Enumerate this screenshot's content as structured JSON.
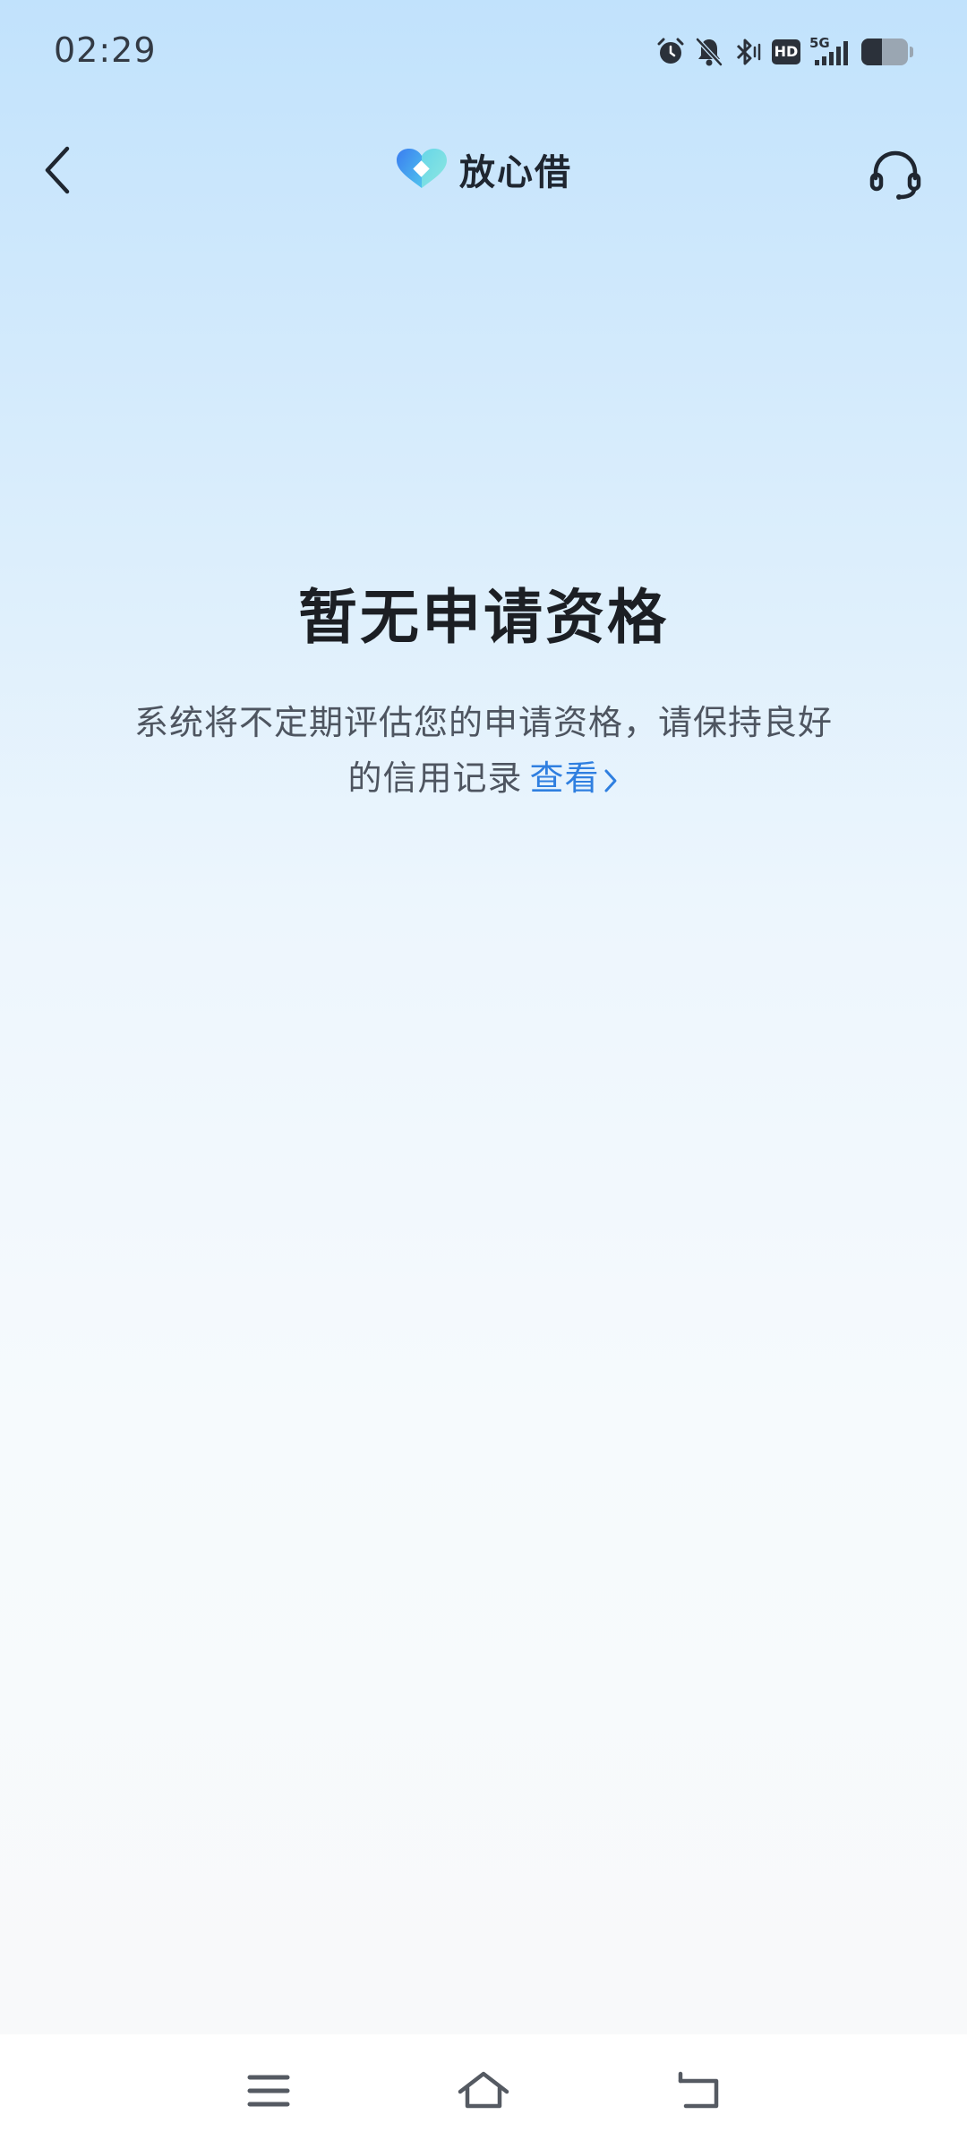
{
  "status_bar": {
    "time": "02:29",
    "icons": [
      "alarm-icon",
      "bell-off-icon",
      "bluetooth-icon",
      "hd-icon",
      "signal-5g-icon",
      "battery-icon"
    ],
    "hd_label": "HD",
    "network_label": "5G",
    "battery_level": 0.45
  },
  "nav": {
    "brand": "放心借",
    "back_icon": "chevron-left-icon",
    "service_icon": "headset-icon"
  },
  "empty_state": {
    "title": "暂无申请资格",
    "description": "系统将不定期评估您的申请资格，请保持良好的信用记录",
    "link_label": "查看"
  },
  "system_nav": {
    "menu_icon": "menu-icon",
    "home_icon": "home-icon",
    "back_icon": "back-icon"
  },
  "colors": {
    "accent": "#2f7fe0",
    "title": "#1c1f24",
    "text": "#4e5560",
    "bg_top": "#c1e2fc",
    "bg_bottom": "#f8f9fa"
  }
}
